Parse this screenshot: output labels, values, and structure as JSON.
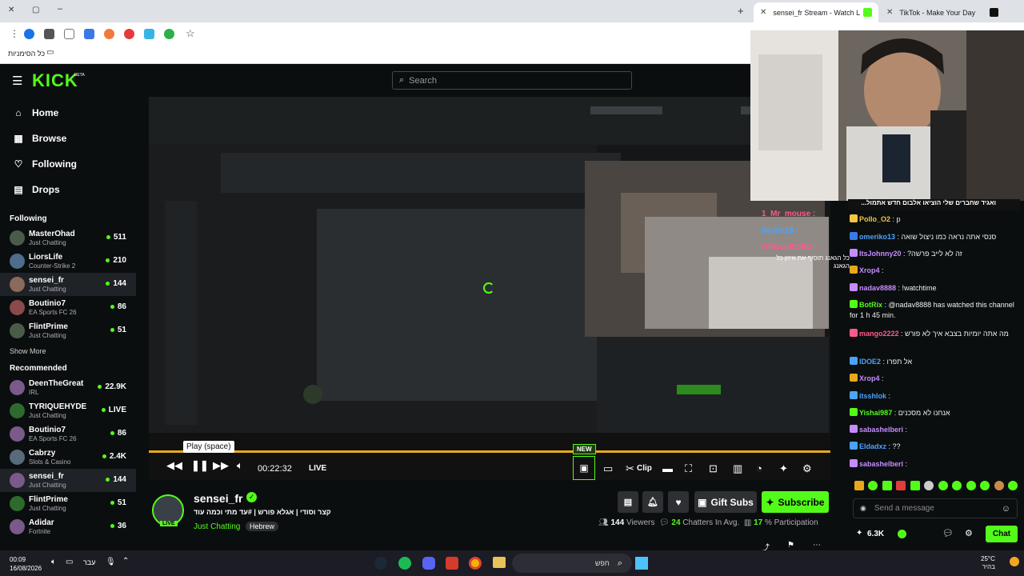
{
  "browser": {
    "tabs": [
      {
        "title": "sensei_fr Stream - Watch Live o",
        "active": true
      },
      {
        "title": "TikTok - Make Your Day",
        "active": false
      }
    ],
    "bookmarks_label": "כל הסימניות"
  },
  "header": {
    "logo": "KICK",
    "logo_badge": "BETA",
    "search_placeholder": "Search"
  },
  "sidebar": {
    "nav": [
      {
        "label": "Home",
        "icon": "home-icon"
      },
      {
        "label": "Browse",
        "icon": "browse-icon"
      },
      {
        "label": "Following",
        "icon": "heart-icon"
      },
      {
        "label": "Drops",
        "icon": "drops-icon"
      }
    ],
    "following_title": "Following",
    "following": [
      {
        "name": "MasterOhad",
        "category": "Just Chatting",
        "viewers": "511"
      },
      {
        "name": "LiorsLife",
        "category": "Counter-Strike 2",
        "viewers": "210"
      },
      {
        "name": "sensei_fr",
        "category": "Just Chatting",
        "viewers": "144"
      },
      {
        "name": "Boutinio7",
        "category": "EA Sports FC 26",
        "viewers": "86"
      },
      {
        "name": "FlintPrime",
        "category": "Just Chatting",
        "viewers": "51"
      }
    ],
    "show_more": "Show More",
    "recommended_title": "Recommended",
    "recommended": [
      {
        "name": "DeenTheGreat",
        "category": "IRL",
        "viewers": "22.9K"
      },
      {
        "name": "TYRIQUEHYDE",
        "category": "Just Chatting",
        "viewers": "LIVE"
      },
      {
        "name": "Boutinio7",
        "category": "EA Sports FC 26",
        "viewers": "86"
      },
      {
        "name": "Cabrzy",
        "category": "Slots & Casino",
        "viewers": "2.4K"
      },
      {
        "name": "sensei_fr",
        "category": "Just Chatting",
        "viewers": "144"
      },
      {
        "name": "FlintPrime",
        "category": "Just Chatting",
        "viewers": "51"
      },
      {
        "name": "Adidar",
        "category": "Fortnite",
        "viewers": "36"
      }
    ]
  },
  "player": {
    "tooltip": "Play (space)",
    "time": "00:22:32",
    "live_label": "LIVE",
    "new_badge": "NEW",
    "clip_label": "Clip",
    "progress": 1.0
  },
  "stream_info": {
    "streamer": "sensei_fr",
    "title": "קצר וסודי | אגלא פורש | #עד מתי וכמה עוד",
    "category": "Just Chatting",
    "tag": "Hebrew",
    "live_badge": "LIVE",
    "gift_label": "Gift Subs",
    "subscribe_label": "Subscribe",
    "viewers": "144",
    "viewers_label": "Viewers",
    "chatters": "24",
    "chatters_label": "Chatters In Avg.",
    "participation": "17",
    "participation_label": "% Participation"
  },
  "chat": {
    "messages": [
      {
        "user": "Pollo_O2",
        "text": ": p",
        "color": "#f5c542"
      },
      {
        "user": "omeriko13",
        "text": ": סנסי אתה נראה כמו ניצול שואה",
        "color": "#4aa3ff"
      },
      {
        "user": "ItsJohnny20",
        "text": ": ?זה לא לייב פרשה",
        "color": "#c58cff"
      },
      {
        "user": "Xrop4",
        "text": ":",
        "color": "#c58cff"
      },
      {
        "user": "nadav8888",
        "text": ": !watchtime",
        "color": "#c58cff"
      },
      {
        "user": "BotRix",
        "text": ": @nadav8888 has watched this channel for 1 h 45 min.",
        "color": "#53fc18"
      },
      {
        "user": "mango2222",
        "text": ": מה אתה יומיות בצבא איך לא פורש",
        "color": "#ff5a8c"
      },
      {
        "user": "IDOE2",
        "text": ": אל תפרו",
        "color": "#4aa3ff"
      },
      {
        "user": "Xrop4",
        "text": ":",
        "color": "#c58cff"
      },
      {
        "user": "itsshlok",
        "text": ":",
        "color": "#4aa3ff"
      },
      {
        "user": "Yishai987",
        "text": ": אנחנו לא מסכנים",
        "color": "#53fc18"
      },
      {
        "user": "sabashelberi",
        "text": ":",
        "color": "#c58cff"
      },
      {
        "user": "Eldadxz",
        "text": ": ??",
        "color": "#4aa3ff"
      },
      {
        "user": "sabashelberi",
        "text": ":",
        "color": "#c58cff"
      }
    ],
    "pinned": "...ואגיד שחברים שלי הוציאו אלבום חדש אתמול",
    "overlay": [
      {
        "user": "1_Mr_mouse",
        "color": "#ff5a8c"
      },
      {
        "user": "ilaybn16",
        "color": "#4aa3ff"
      },
      {
        "user": "OfficialBOBO",
        "color": "#ff5a8c"
      }
    ],
    "overlay_text": "כל הגאנג תוסיף את איזון כל הגאנג",
    "input_placeholder": "Send a message",
    "points": "6.3K",
    "chat_button": "Chat"
  },
  "taskbar": {
    "time": "00:09",
    "date": "16/08/2026",
    "lang": "עבר",
    "search_label": "חפש",
    "temp": "25°C",
    "weather": "בהיר"
  }
}
